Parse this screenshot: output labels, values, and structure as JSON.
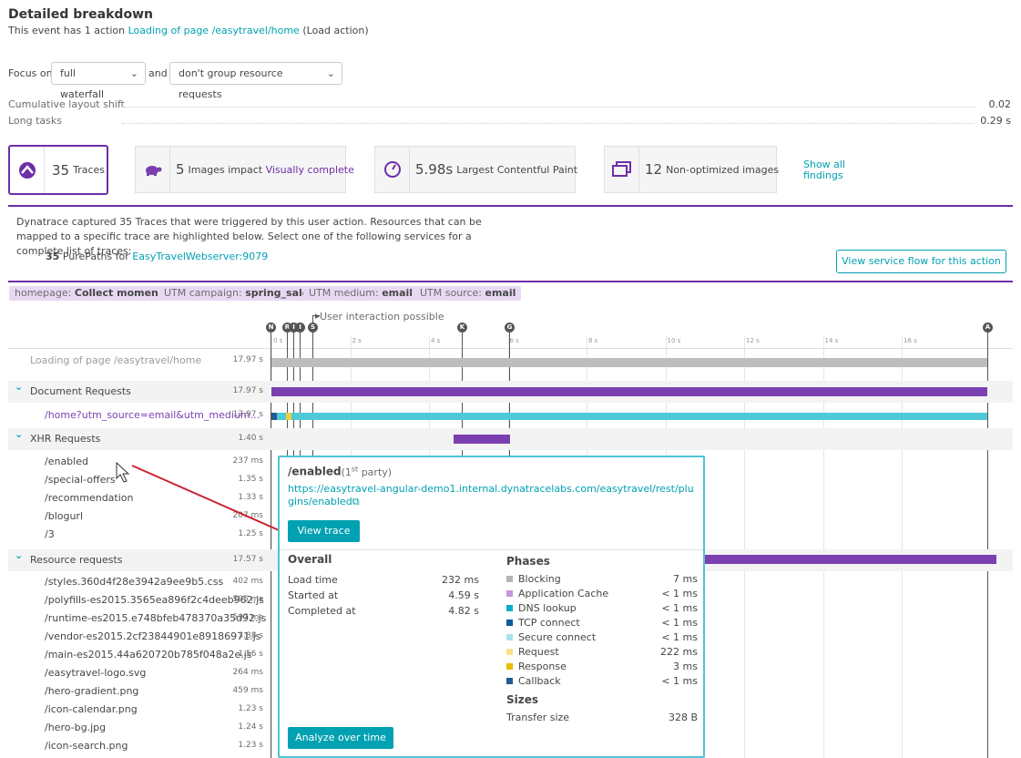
{
  "header": {
    "title": "Detailed breakdown",
    "sub_prefix": "This event has 1 action",
    "sub_link": "Loading of page /easytravel/home",
    "sub_suffix": "(Load action)"
  },
  "focus": {
    "label": "Focus on",
    "select1": "full waterfall",
    "and": "and",
    "select2": "don't group resource requests"
  },
  "metrics": [
    {
      "label": "Cumulative layout shift",
      "value": "0.02"
    },
    {
      "label": "Long tasks",
      "value": "0.29 s"
    }
  ],
  "cards": [
    {
      "count": "35",
      "label": "Traces"
    },
    {
      "count": "5",
      "label": "Images impact",
      "link": "Visually complete"
    },
    {
      "count": "5.98s",
      "label": "Largest Contentful Paint"
    },
    {
      "count": "12",
      "label": "Non-optimized images"
    }
  ],
  "show_all": "Show all findings",
  "description": "Dynatrace captured 35 Traces that were triggered by this user action. Resources that can be mapped to a specific trace are highlighted below. Select one of the following services for a complete list of traces:",
  "purepaths": {
    "count": "35",
    "text": "PurePaths for",
    "service": "EasyTravelWebserver:9079"
  },
  "view_service_flow": "View service flow for this action",
  "tags": [
    {
      "key": "homepage:",
      "value": "Collect moments"
    },
    {
      "key": "UTM campaign:",
      "value": "spring_sale"
    },
    {
      "key": "UTM medium:",
      "value": "email"
    },
    {
      "key": "UTM source:",
      "value": "email"
    }
  ],
  "timeline": {
    "interaction_label": "User interaction possible",
    "ticks": [
      "0 s",
      "2 s",
      "4 s",
      "6 s",
      "8 s",
      "10 s",
      "12 s",
      "14 s",
      "16 s"
    ],
    "markers": [
      "N",
      "R",
      "I",
      "I",
      "S",
      "K",
      "G",
      "A"
    ]
  },
  "rows": [
    {
      "name": "Loading of page /easytravel/home",
      "dur": "17.97 s"
    },
    {
      "name": "Document Requests",
      "dur": "17.97 s"
    },
    {
      "name": "/home?utm_source=email&utm_medium...",
      "dur": "17.97 s"
    },
    {
      "name": "XHR Requests",
      "dur": "1.40 s"
    },
    {
      "name": "/enabled",
      "dur": "237 ms"
    },
    {
      "name": "/special-offers",
      "dur": "1.35 s"
    },
    {
      "name": "/recommendation",
      "dur": "1.33 s"
    },
    {
      "name": "/blogurl",
      "dur": "207 ms"
    },
    {
      "name": "/3",
      "dur": "1.25 s"
    },
    {
      "name": "Resource requests",
      "dur": "17.57 s"
    },
    {
      "name": "/styles.360d4f28e3942a9ee9b5.css",
      "dur": "402 ms"
    },
    {
      "name": "/polyfills-es2015.3565ea896f2c4deeb962.js",
      "dur": "595 ms"
    },
    {
      "name": "/runtime-es2015.e748bfeb478370a35d92.js",
      "dur": "597 ms"
    },
    {
      "name": "/vendor-es2015.2cf23844901e89186971.js",
      "dur": "3.88 s"
    },
    {
      "name": "/main-es2015.44a620720b785f048a2e.js",
      "dur": "1.56 s"
    },
    {
      "name": "/easytravel-logo.svg",
      "dur": "264 ms"
    },
    {
      "name": "/hero-gradient.png",
      "dur": "459 ms"
    },
    {
      "name": "/icon-calendar.png",
      "dur": "1.23 s"
    },
    {
      "name": "/hero-bg.jpg",
      "dur": "1.24 s"
    },
    {
      "name": "/icon-search.png",
      "dur": "1.23 s"
    }
  ],
  "popup": {
    "title": "/enabled",
    "party_num": "1",
    "party_sup": "st",
    "party_word": "party",
    "url": "https://easytravel-angular-demo1.internal.dynatracelabs.com/easytravel/rest/plugins/enabled",
    "view_trace": "View trace",
    "overall_title": "Overall",
    "overall": [
      {
        "label": "Load time",
        "value": "232 ms"
      },
      {
        "label": "Started at",
        "value": "4.59 s"
      },
      {
        "label": "Completed at",
        "value": "4.82 s"
      }
    ],
    "phases_title": "Phases",
    "phases": [
      {
        "label": "Blocking",
        "value": "7 ms",
        "color": "#b4b4b4"
      },
      {
        "label": "Application Cache",
        "value": "< 1 ms",
        "color": "#c995dd"
      },
      {
        "label": "DNS lookup",
        "value": "< 1 ms",
        "color": "#00b0c8"
      },
      {
        "label": "TCP connect",
        "value": "< 1 ms",
        "color": "#0a5c9e"
      },
      {
        "label": "Secure connect",
        "value": "< 1 ms",
        "color": "#a8e4ef"
      },
      {
        "label": "Request",
        "value": "222 ms",
        "color": "#f8e38c"
      },
      {
        "label": "Response",
        "value": "3 ms",
        "color": "#e6be00"
      },
      {
        "label": "Callback",
        "value": "< 1 ms",
        "color": "#1f5b8f"
      }
    ],
    "sizes_title": "Sizes",
    "sizes": [
      {
        "label": "Transfer size",
        "value": "328 B"
      }
    ],
    "analyze": "Analyze over time"
  }
}
